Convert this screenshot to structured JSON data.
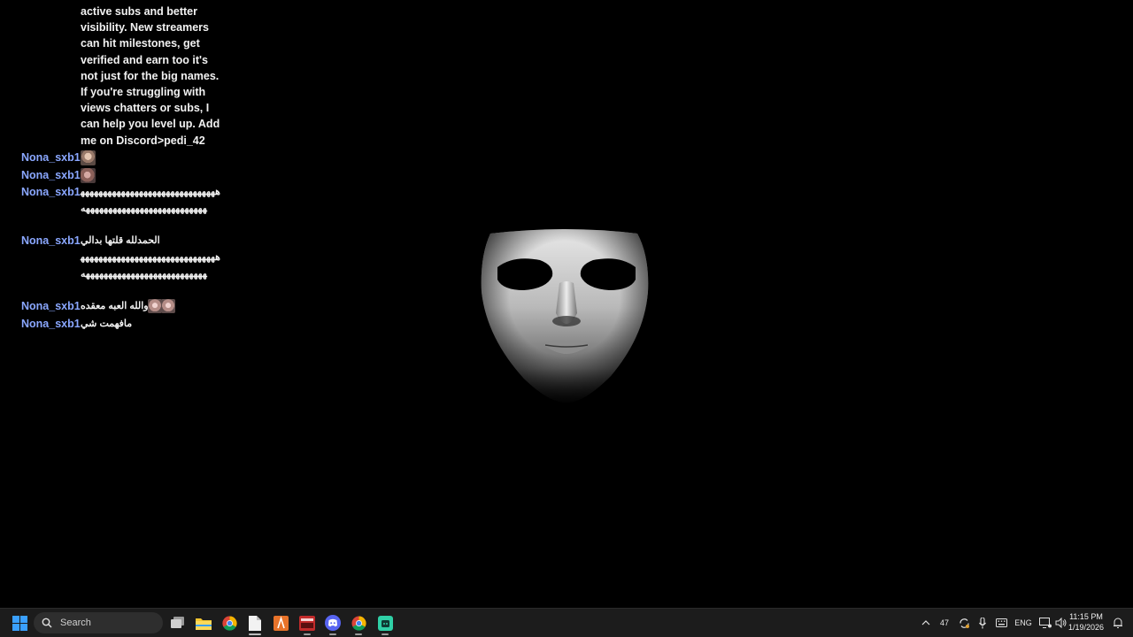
{
  "chat": {
    "continued_message": "active subs and better visibility. New streamers can hit milestones, get verified and earn too it's not just for the big names. If you're struggling with views chatters or subs, I can help you level up. Add me on Discord>pedi_42",
    "messages": [
      {
        "user": "Nona_sxb1",
        "text": "",
        "emote": "face-emote"
      },
      {
        "user": "Nona_sxb1",
        "text": "",
        "emote": "face-emote"
      },
      {
        "user": "Nona_sxb1",
        "text": "ههههههههههههههههههههههههههههههههههههههههههههههههههههههههههه"
      },
      {
        "user": "Nona_sxb1",
        "text": "الحمدلله قلتها بدالي",
        "text2": "ههههههههههههههههههههههههههههههههههههههههههههههههههههههههههه"
      },
      {
        "user": "Nona_sxb1",
        "text": "والله العبه معقده",
        "emote": "face-emote"
      },
      {
        "user": "Nona_sxb1",
        "text": "مافهمت شي"
      }
    ]
  },
  "taskbar": {
    "search_label": "Search",
    "apps": [
      "task-view-icon",
      "file-explorer-icon",
      "chrome-icon",
      "notepad-icon",
      "app-orange-icon",
      "app-red-icon",
      "discord-icon",
      "chrome-icon",
      "app-teal-icon"
    ],
    "tray": {
      "badge_number": "47",
      "language": "ENG",
      "time": "11:15 PM",
      "date": "1/19/2026"
    }
  },
  "colors": {
    "username": "#8aa7ff",
    "taskbar_bg": "#1c1c1c",
    "background": "#000000"
  }
}
